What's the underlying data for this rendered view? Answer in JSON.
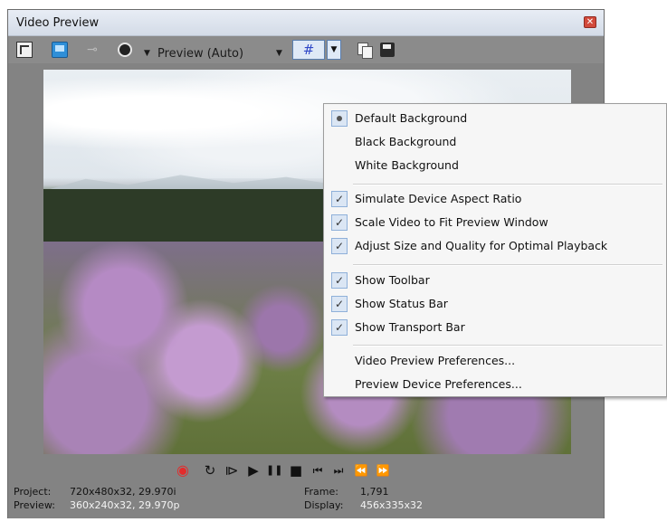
{
  "window": {
    "title": "Video Preview",
    "close_glyph": "✕"
  },
  "toolbar": {
    "icons": [
      "properties-icon",
      "external-monitor-icon",
      "split-screen-icon",
      "overlay-icon",
      "copy-snapshot-icon",
      "save-snapshot-icon"
    ],
    "preview_quality": "Preview (Auto)",
    "grid_glyph": "#",
    "dropdown_glyph": "▼"
  },
  "menu": {
    "items": [
      {
        "label": "Default Background",
        "state": "radio"
      },
      {
        "label": "Black Background",
        "state": "none"
      },
      {
        "label": "White Background",
        "state": "none"
      },
      {
        "label": "Simulate Device Aspect Ratio",
        "state": "checked"
      },
      {
        "label": "Scale Video to Fit Preview Window",
        "state": "checked"
      },
      {
        "label": "Adjust Size and Quality for Optimal Playback",
        "state": "checked"
      },
      {
        "label": "Show Toolbar",
        "state": "checked"
      },
      {
        "label": "Show Status Bar",
        "state": "checked"
      },
      {
        "label": "Show Transport Bar",
        "state": "checked"
      },
      {
        "label": "Video Preview Preferences...",
        "state": "none"
      },
      {
        "label": "Preview Device Preferences...",
        "state": "none"
      }
    ],
    "check_glyph": "✓"
  },
  "transport": {
    "glyphs": {
      "record": "◉",
      "loop": "↻",
      "play_from_start": "⧐",
      "play": "▶",
      "pause": "❚❚",
      "stop": "■",
      "prev": "⏮",
      "next": "⏭",
      "prev_frame": "⏪",
      "next_frame": "⏩"
    }
  },
  "status": {
    "project_label": "Project:",
    "project_value": "720x480x32, 29.970i",
    "preview_label": "Preview:",
    "preview_value": "360x240x32, 29.970p",
    "frame_label": "Frame:",
    "frame_value": "1,791",
    "display_label": "Display:",
    "display_value": "456x335x32"
  }
}
